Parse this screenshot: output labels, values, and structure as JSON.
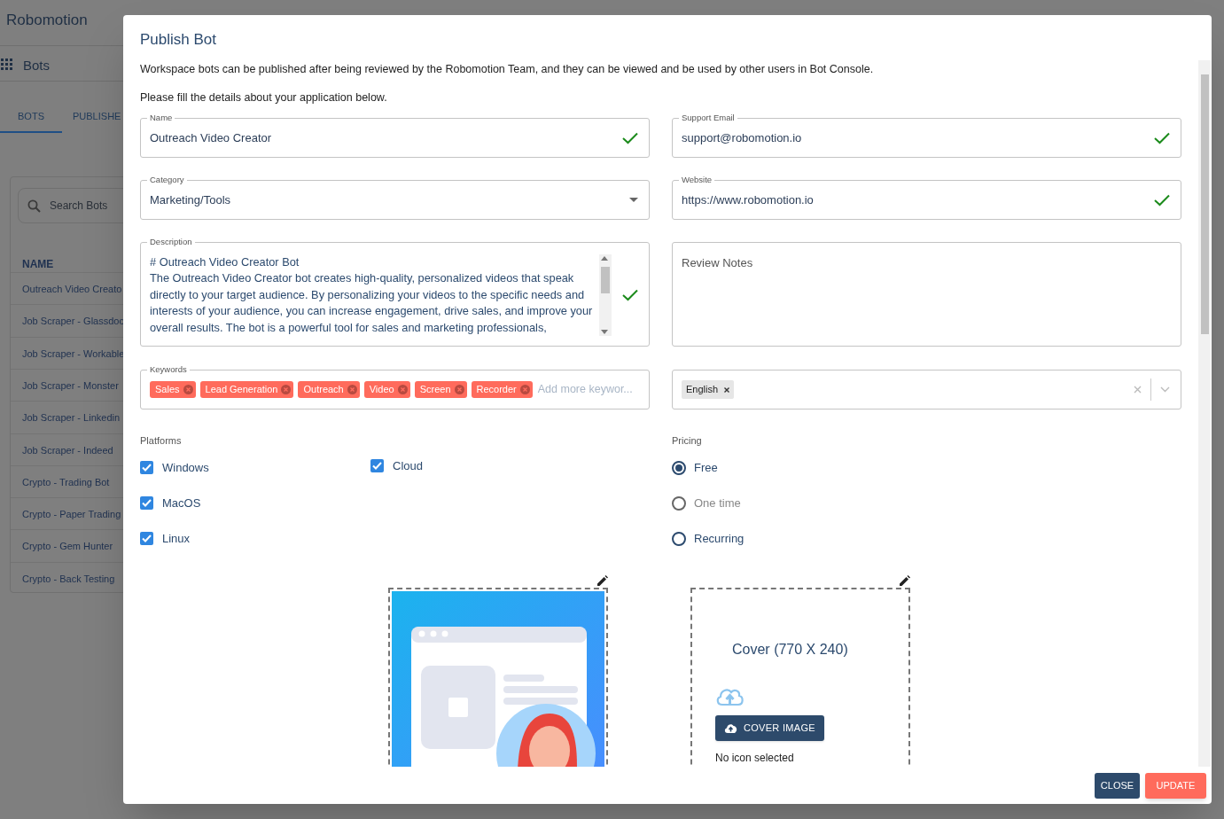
{
  "background_app": {
    "app_title": "Robomotion",
    "section_title": "Bots",
    "tabs": [
      {
        "label": "BOTS",
        "selected": true
      },
      {
        "label": "PUBLISHE",
        "selected": false
      }
    ],
    "search": {
      "placeholder": "Search Bots"
    },
    "table": {
      "columns": [
        "NAME"
      ],
      "rows": [
        "Outreach Video Creato",
        "Job Scraper - Glassdoc",
        "Job Scraper - Workable",
        "Job Scraper - Monster",
        "Job Scraper - Linkedin",
        "Job Scraper - Indeed",
        "Crypto - Trading Bot",
        "Crypto - Paper Trading",
        "Crypto - Gem Hunter",
        "Crypto - Back Testing"
      ]
    }
  },
  "dialog": {
    "title": "Publish Bot",
    "intro": "Workspace bots can be published after being reviewed by the Robomotion Team, and they can be viewed and be used by other users in Bot Console.",
    "instruction": "Please fill the details about your application below.",
    "name": {
      "label": "Name",
      "value": "Outreach Video Creator",
      "valid": true
    },
    "support_email": {
      "label": "Support Email",
      "value": "support@robomotion.io",
      "valid": true
    },
    "category": {
      "label": "Category",
      "value": "Marketing/Tools"
    },
    "website": {
      "label": "Website",
      "value": "https://www.robomotion.io",
      "valid": true
    },
    "description": {
      "label": "Description",
      "valid": true,
      "lines": [
        "# Outreach Video Creator Bot",
        "The Outreach Video Creator bot creates high-quality, personalized videos that speak directly to your target audience. By personalizing your videos to the specific needs and interests of your audience, you can increase engagement, drive sales, and improve your overall results. The bot is a powerful tool for sales and marketing professionals,"
      ]
    },
    "review_notes": {
      "placeholder": "Review Notes"
    },
    "keywords": {
      "label": "Keywords",
      "tags": [
        "Sales",
        "Lead Generation",
        "Outreach",
        "Video",
        "Screen",
        "Recorder"
      ],
      "placeholder": "Add more keywor..."
    },
    "languages": {
      "tags": [
        "English"
      ]
    },
    "platforms": {
      "label": "Platforms",
      "options": [
        {
          "label": "Windows",
          "checked": true
        },
        {
          "label": "MacOS",
          "checked": true
        },
        {
          "label": "Linux",
          "checked": true
        },
        {
          "label": "Cloud",
          "checked": true
        }
      ]
    },
    "pricing": {
      "label": "Pricing",
      "options": [
        {
          "label": "Free",
          "selected": true,
          "disabled": false
        },
        {
          "label": "One time",
          "selected": false,
          "disabled": true
        },
        {
          "label": "Recurring",
          "selected": false,
          "disabled": false
        }
      ]
    },
    "cover_upload": {
      "title": "Cover (770 X 240)",
      "button": "COVER IMAGE",
      "status": "No icon selected"
    },
    "buttons": [
      {
        "label": "CLOSE",
        "kind": "secondary"
      },
      {
        "label": "UPDATE",
        "kind": "primary"
      }
    ]
  }
}
